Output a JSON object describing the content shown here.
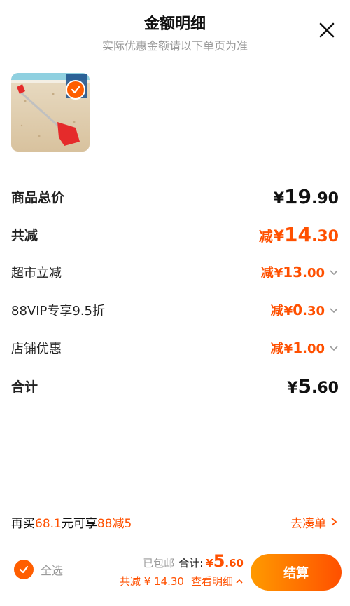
{
  "header": {
    "title": "金额明细",
    "subtitle": "实际优惠金额请以下单页为准"
  },
  "rows": {
    "total_price": {
      "label": "商品总价",
      "currency": "¥",
      "int": "19",
      "dec": ".90"
    },
    "total_discount": {
      "label": "共减",
      "prefix": "减",
      "currency": "¥",
      "int": "14",
      "dec": ".30"
    },
    "supermarket": {
      "label": "超市立减",
      "prefix": "减",
      "currency": "¥",
      "int": "13",
      "dec": ".00"
    },
    "vip": {
      "label": "88VIP专享9.5折",
      "prefix": "减",
      "currency": "¥",
      "int": "0",
      "dec": ".30"
    },
    "shop": {
      "label": "店铺优惠",
      "prefix": "减",
      "currency": "¥",
      "int": "1",
      "dec": ".00"
    },
    "sum": {
      "label": "合计",
      "currency": "¥",
      "int": "5",
      "dec": ".60"
    }
  },
  "promo": {
    "p1": "再买",
    "amount": "68.1",
    "p2": "元可享",
    "deal": "88减5",
    "link": "去凑单"
  },
  "bottom": {
    "select_all": "全选",
    "free_shipping": "已包邮",
    "total_label": "合计:",
    "currency": "¥",
    "int": "5",
    "dec": ".60",
    "discount_text": "共减 ¥ 14.30",
    "detail_link": "查看明细",
    "checkout": "结算"
  },
  "colors": {
    "accent": "#ff5000",
    "muted": "#999999"
  }
}
